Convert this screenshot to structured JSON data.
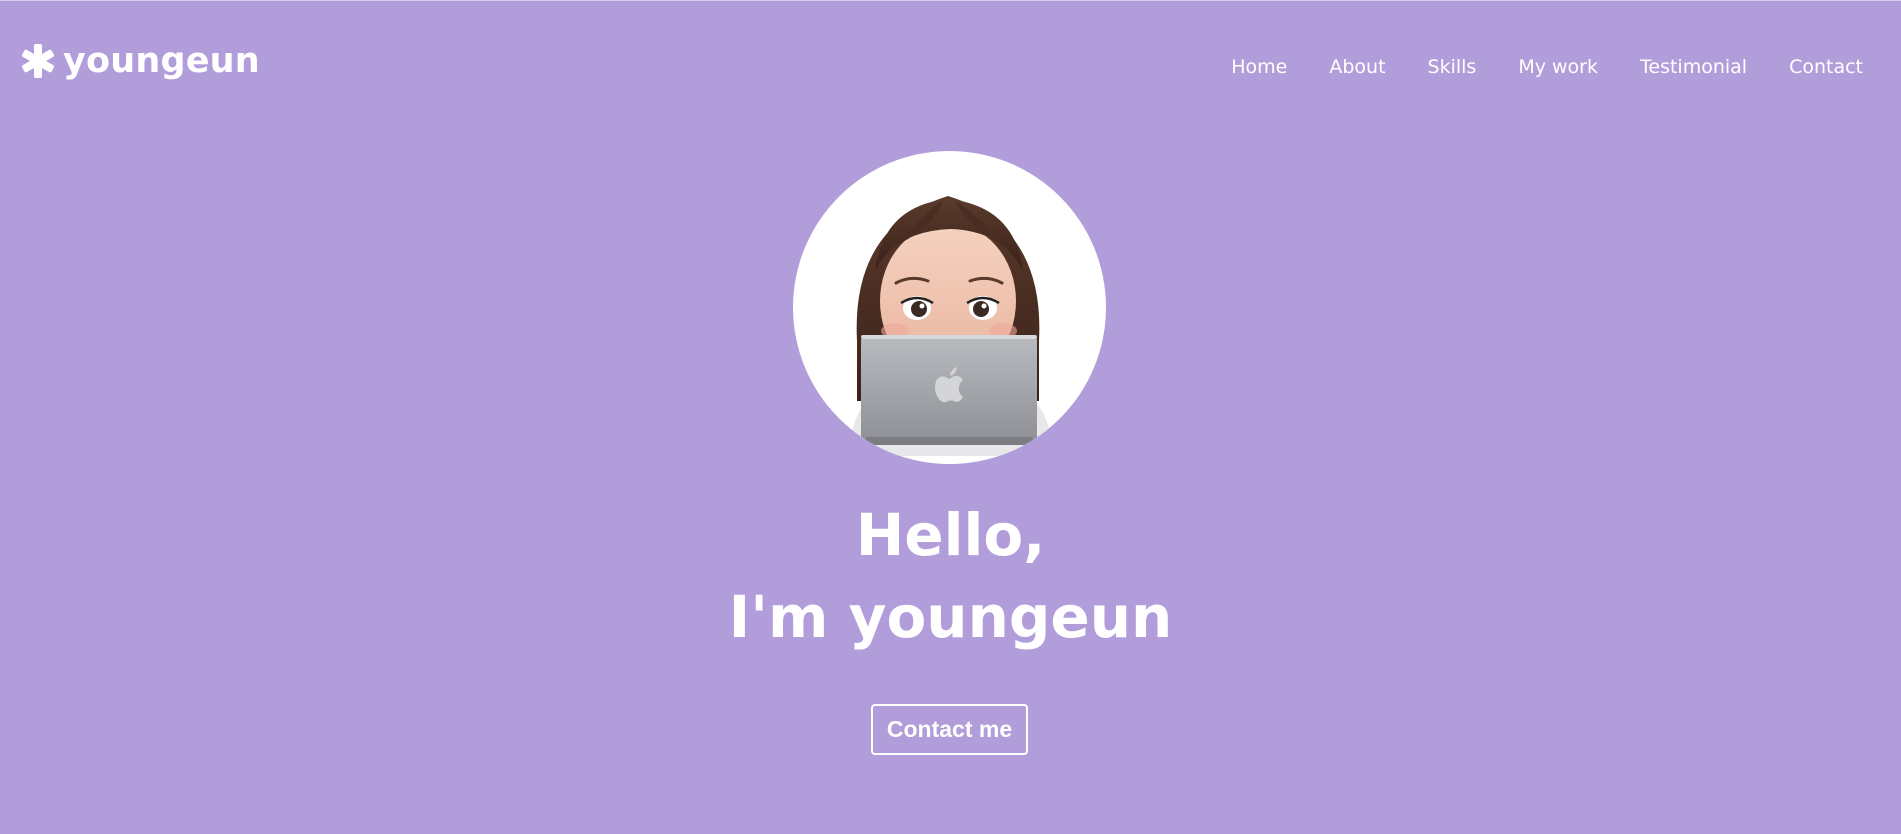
{
  "navbar": {
    "logo_text": "youngeun",
    "menu": [
      {
        "label": "Home"
      },
      {
        "label": "About"
      },
      {
        "label": "Skills"
      },
      {
        "label": "My work"
      },
      {
        "label": "Testimonial"
      },
      {
        "label": "Contact"
      }
    ]
  },
  "hero": {
    "title_line1": "Hello,",
    "title_line2": "I'm youngeun",
    "cta_label": "Contact me"
  },
  "colors": {
    "background": "#b29ddb",
    "text": "#ffffff"
  },
  "icons": {
    "logo": "asterisk-icon",
    "avatar": "memoji-laptop-avatar"
  }
}
